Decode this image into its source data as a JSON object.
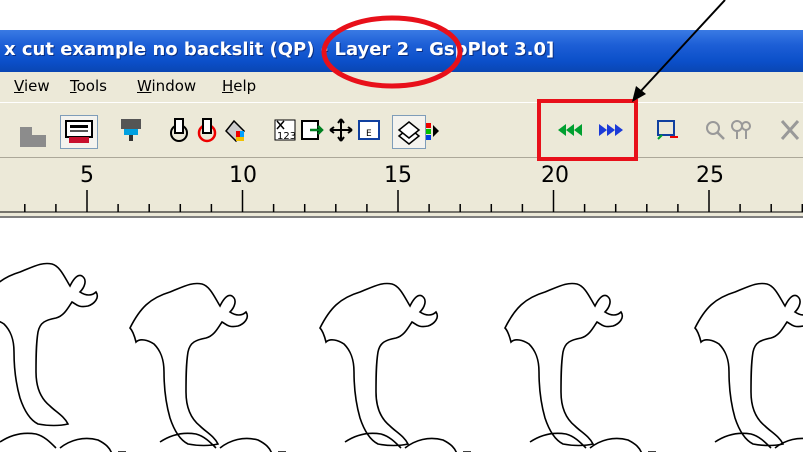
{
  "window": {
    "title": "x cut example no backslit (QP) - Layer 2 - GspPlot 3.0]"
  },
  "menu": {
    "items": [
      {
        "label": "View",
        "underline": "V",
        "rest": "iew"
      },
      {
        "label": "Tools",
        "underline": "T",
        "rest": "ools"
      },
      {
        "label": "Window",
        "underline": "W",
        "rest": "indow"
      },
      {
        "label": "Help",
        "underline": "H",
        "rest": "elp"
      }
    ]
  },
  "toolbar": {
    "icons": [
      "layer-shape-icon",
      "plot-preview-icon",
      "network-plotter-icon",
      "tool-position-icon",
      "tool-origin-icon",
      "color-fill-icon",
      "number-sequence-icon",
      "export-icon",
      "move-cross-icon",
      "edge-box-icon",
      "layers-icon",
      "color-marks-icon",
      "rewind-icon",
      "fast-forward-icon",
      "select-rect-icon",
      "zoom-icon",
      "node-edit-icon",
      "cut-tool-icon"
    ]
  },
  "ruler": {
    "labels": [
      "5",
      "10",
      "15",
      "20",
      "25"
    ]
  },
  "colors": {
    "titlebar": "#0b4fc9",
    "highlight": "#e8101a",
    "rewind_arrows": "#00a030",
    "forward_arrows": "#1a3ad8"
  }
}
